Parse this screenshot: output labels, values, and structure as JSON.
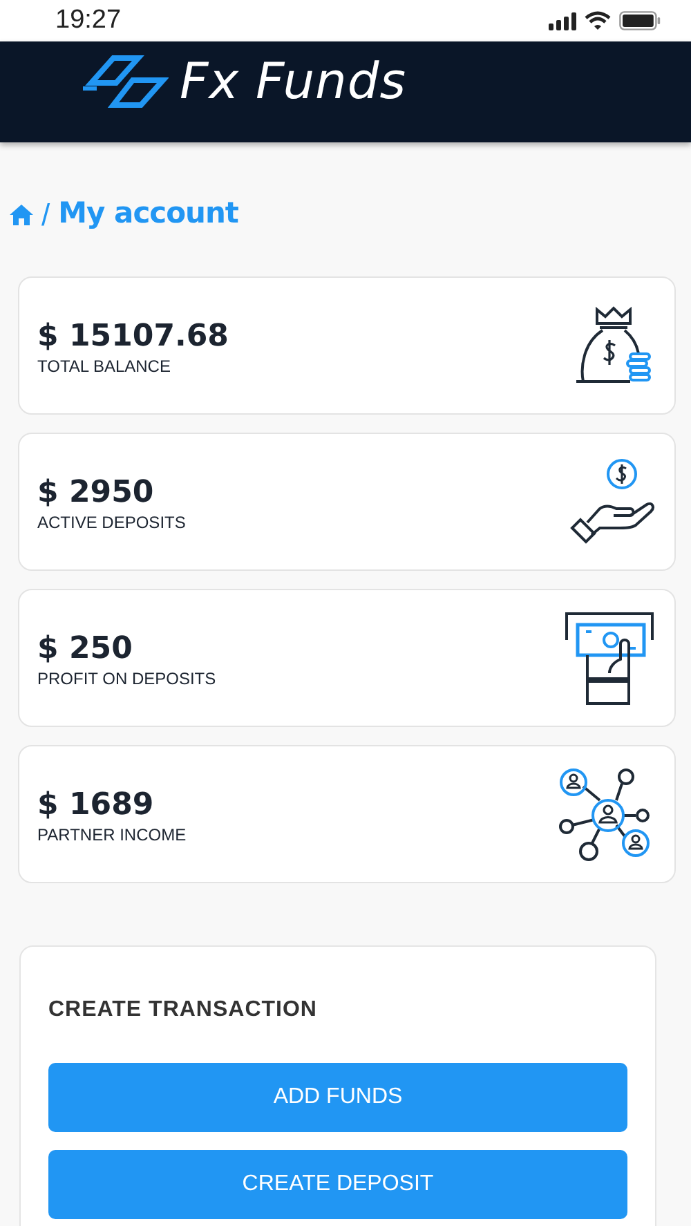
{
  "status_bar": {
    "time": "19:27"
  },
  "header": {
    "brand": "Fx Funds"
  },
  "breadcrumb": {
    "current": "My account",
    "separator": "/"
  },
  "cards": [
    {
      "kind": "money-bag",
      "amount": "$ 15107.68",
      "label": "TOTAL BALANCE"
    },
    {
      "kind": "hand-coin",
      "amount": "$ 2950",
      "label": "ACTIVE DEPOSITS"
    },
    {
      "kind": "cash-slot",
      "amount": "$ 250",
      "label": "PROFIT ON DEPOSITS"
    },
    {
      "kind": "network",
      "amount": "$ 1689",
      "label": "PARTNER INCOME"
    }
  ],
  "transaction": {
    "title": "CREATE TRANSACTION",
    "buttons": [
      "ADD FUNDS",
      "CREATE DEPOSIT"
    ]
  }
}
